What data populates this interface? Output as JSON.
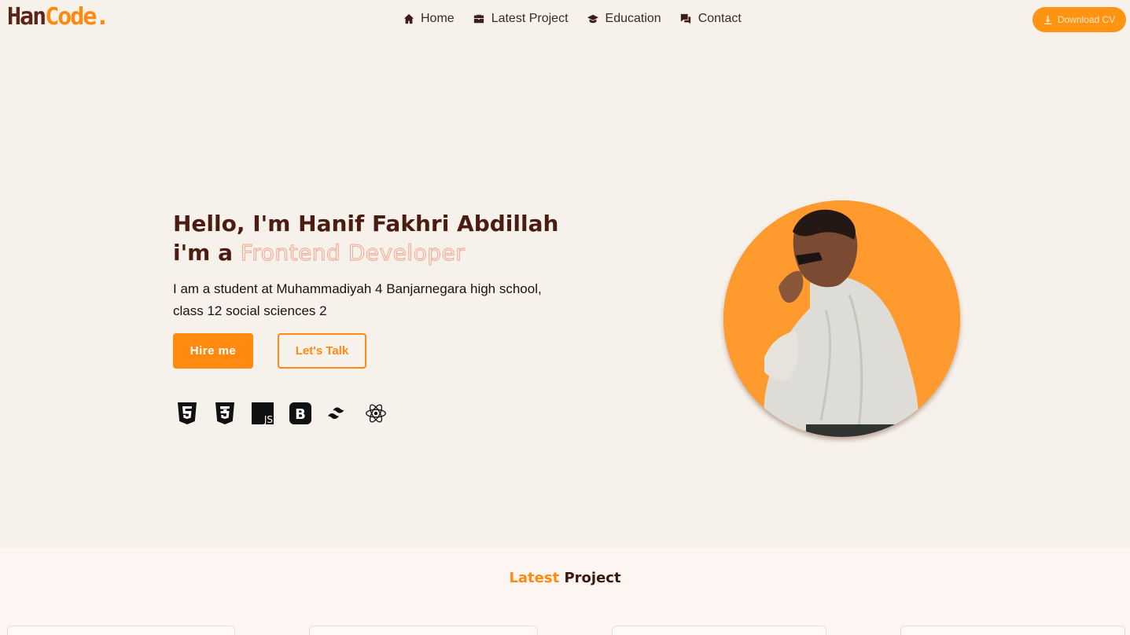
{
  "brand": {
    "part1": "Han",
    "part2": "Code."
  },
  "nav": {
    "items": [
      {
        "label": "Home",
        "icon": "home-icon"
      },
      {
        "label": "Latest Project",
        "icon": "briefcase-icon"
      },
      {
        "label": "Education",
        "icon": "graduation-cap-icon"
      },
      {
        "label": "Contact",
        "icon": "chat-icon"
      }
    ],
    "cv_label": "Download CV"
  },
  "hero": {
    "greeting": "Hello, I'm Hanif Fakhri Abdillah",
    "prefix": "i'm a",
    "role": "Frontend Developer",
    "description": "I am a student at Muhammadiyah 4 Banjarnegara high school, class 12 social sciences 2",
    "hire_label": "Hire me",
    "talk_label": "Let's Talk",
    "tech_icons": [
      "html5-icon",
      "css3-icon",
      "javascript-icon",
      "bootstrap-icon",
      "tailwind-icon",
      "react-icon"
    ]
  },
  "latest": {
    "accent": "Latest",
    "rest": "Project"
  },
  "colors": {
    "accent": "#ff8a0f",
    "brand_dark": "#5a2418",
    "background": "#f6f1ea"
  }
}
